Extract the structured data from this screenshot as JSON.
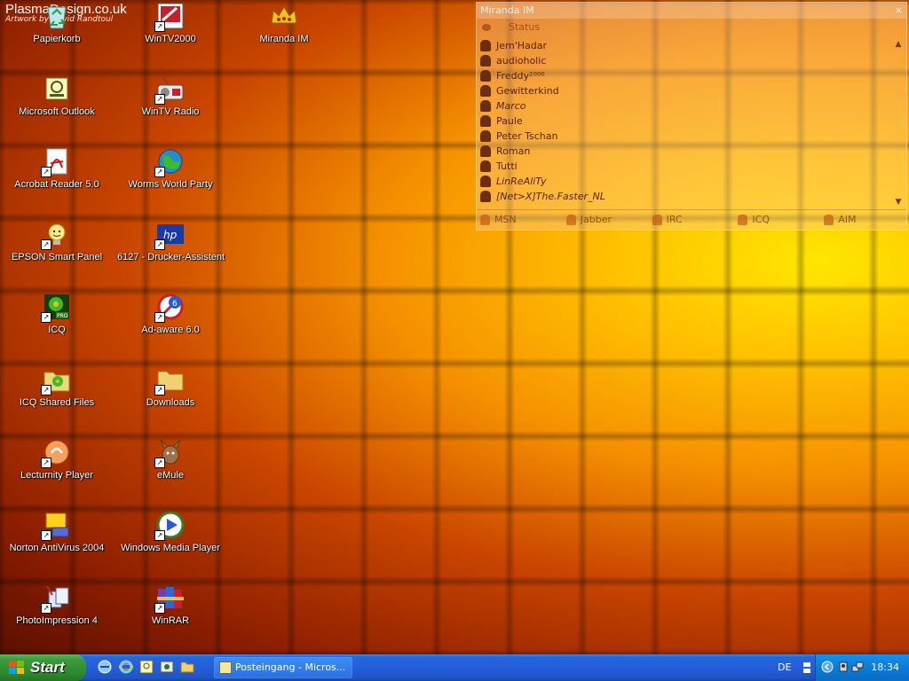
{
  "branding": {
    "line1": "PlasmaDesign.co.uk",
    "line2": "Artwork by David Randtoul"
  },
  "desktop_icons": [
    {
      "label": "Papierkorb"
    },
    {
      "label": "WinTV2000"
    },
    {
      "label": "Miranda IM"
    },
    {
      "label": "Microsoft Outlook"
    },
    {
      "label": "WinTV Radio"
    },
    {
      "label": "Acrobat Reader 5.0"
    },
    {
      "label": "Worms World Party"
    },
    {
      "label": "EPSON Smart Panel"
    },
    {
      "label": "6127 - Drucker-Assistent"
    },
    {
      "label": "ICQ"
    },
    {
      "label": "Ad-aware 6.0"
    },
    {
      "label": "ICQ Shared Files"
    },
    {
      "label": "Downloads"
    },
    {
      "label": "Lecturnity Player"
    },
    {
      "label": "eMule"
    },
    {
      "label": "Norton AntiVirus 2004"
    },
    {
      "label": "Windows Media Player"
    },
    {
      "label": "PhotoImpression 4"
    },
    {
      "label": "WinRAR"
    }
  ],
  "miranda": {
    "title": "Miranda IM",
    "status": "Status",
    "close": "×",
    "contacts": [
      {
        "name": "Jem'Hadar"
      },
      {
        "name": "audioholic"
      },
      {
        "name": "Freddy²⁰⁰⁰"
      },
      {
        "name": "Gewitterkind"
      },
      {
        "name": "Marco"
      },
      {
        "name": "Paule"
      },
      {
        "name": "Peter Tschan"
      },
      {
        "name": "Roman"
      },
      {
        "name": "Tutti"
      },
      {
        "name": "LinReAliTy"
      },
      {
        "name": "[Net>X]The.Faster_NL"
      }
    ],
    "protocols": [
      {
        "label": "MSN"
      },
      {
        "label": "Jabber"
      },
      {
        "label": "IRC"
      },
      {
        "label": "ICQ"
      },
      {
        "label": "AIM"
      }
    ]
  },
  "taskbar": {
    "start_label": "Start",
    "task_button": "Posteingang - Micros...",
    "language": "DE",
    "clock": "18:34"
  }
}
